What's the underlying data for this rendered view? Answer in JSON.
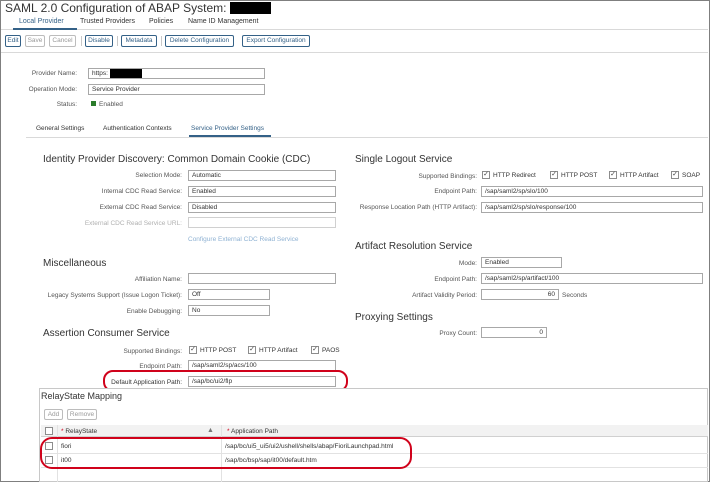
{
  "window": {
    "title": "SAML 2.0 Configuration of ABAP System: "
  },
  "topnav": {
    "tabs": [
      "Local Provider",
      "Trusted Providers",
      "Policies",
      "Name ID Management"
    ]
  },
  "toolbar": {
    "edit": "Edit",
    "save": "Save",
    "cancel": "Cancel",
    "disable": "Disable",
    "metadata": "Metadata",
    "delete": "Delete Configuration",
    "export": "Export Configuration"
  },
  "provider": {
    "name_label": "Provider Name:",
    "name_value": "https:",
    "mode_label": "Operation Mode:",
    "mode_value": "Service Provider",
    "status_label": "Status:",
    "status_value": "Enabled"
  },
  "subtabs": [
    "General Settings",
    "Authentication Contexts",
    "Service Provider Settings"
  ],
  "idp_discovery": {
    "title": "Identity Provider Discovery: Common Domain Cookie (CDC)",
    "selection_mode_label": "Selection Mode:",
    "selection_mode_value": "Automatic",
    "internal_label": "Internal CDC Read Service:",
    "internal_value": "Enabled",
    "external_label": "External CDC Read Service:",
    "external_value": "Disabled",
    "external_url_label": "External CDC Read Service URL:",
    "configure_link": "Configure External CDC Read Service"
  },
  "misc": {
    "title": "Miscellaneous",
    "affiliation_label": "Affiliation Name:",
    "affiliation_value": "",
    "legacy_label": "Legacy Systems Support (Issue Logon Ticket):",
    "legacy_value": "Off",
    "debug_label": "Enable Debugging:",
    "debug_value": "No"
  },
  "acs": {
    "title": "Assertion Consumer Service",
    "bindings_label": "Supported Bindings:",
    "bindings": [
      "HTTP POST",
      "HTTP Artifact",
      "PAOS"
    ],
    "endpoint_label": "Endpoint Path:",
    "endpoint_value": "/sap/saml2/sp/acs/100",
    "default_app_label": "Default Application Path:",
    "default_app_value": "/sap/bc/ui2/flp"
  },
  "slo": {
    "title": "Single Logout Service",
    "bindings_label": "Supported Bindings:",
    "bindings": [
      "HTTP Redirect",
      "HTTP POST",
      "HTTP Artifact",
      "SOAP"
    ],
    "endpoint_label": "Endpoint Path:",
    "endpoint_value": "/sap/saml2/sp/slo/100",
    "response_label": "Response Location Path (HTTP Artifact):",
    "response_value": "/sap/saml2/sp/slo/response/100"
  },
  "ars": {
    "title": "Artifact Resolution Service",
    "mode_label": "Mode:",
    "mode_value": "Enabled",
    "endpoint_label": "Endpoint Path:",
    "endpoint_value": "/sap/saml2/sp/artifact/100",
    "validity_label": "Artifact Validity Period:",
    "validity_value": "60",
    "validity_unit": "Seconds"
  },
  "proxying": {
    "title": "Proxying Settings",
    "proxy_count_label": "Proxy Count:",
    "proxy_count_value": "0"
  },
  "relaystate": {
    "title": "RelayState Mapping",
    "add": "Add",
    "remove": "Remove",
    "col_relaystate": "RelayState",
    "col_app_path": "Application Path",
    "required_mark": "*",
    "rows": [
      {
        "relaystate": "fiori",
        "path": "/sap/bc/ui5_ui5/ui2/ushell/shells/abap/FioriLaunchpad.html"
      },
      {
        "relaystate": "it00",
        "path": "/sap/bc/bsp/sap/it00/default.htm"
      }
    ]
  },
  "colors": {
    "accent": "#346187",
    "highlight": "#d0021b",
    "status_ok": "#2b7c2b"
  }
}
